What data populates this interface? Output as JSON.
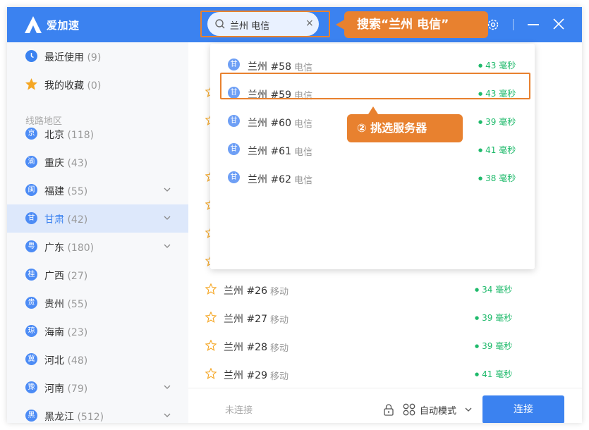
{
  "app": {
    "name": "爱加速"
  },
  "search": {
    "value": "兰州 电信",
    "clear": "×"
  },
  "callouts": {
    "search": "搜索“兰州 电信”",
    "pick": "② 挑选服务器"
  },
  "sidebar": {
    "top": [
      {
        "label": "最近使用",
        "count": "(9)"
      },
      {
        "label": "我的收藏",
        "count": "(0)"
      }
    ],
    "section_label": "线路地区",
    "regions": [
      {
        "badge": "京",
        "label": "北京",
        "count": "(118)",
        "expand": false
      },
      {
        "badge": "渝",
        "label": "重庆",
        "count": "(43)",
        "expand": false
      },
      {
        "badge": "闽",
        "label": "福建",
        "count": "(55)",
        "expand": true
      },
      {
        "badge": "甘",
        "label": "甘肃",
        "count": "(42)",
        "expand": true,
        "active": true
      },
      {
        "badge": "粤",
        "label": "广东",
        "count": "(180)",
        "expand": true
      },
      {
        "badge": "桂",
        "label": "广西",
        "count": "(27)",
        "expand": false
      },
      {
        "badge": "贵",
        "label": "贵州",
        "count": "(55)",
        "expand": false
      },
      {
        "badge": "琼",
        "label": "海南",
        "count": "(23)",
        "expand": false
      },
      {
        "badge": "冀",
        "label": "河北",
        "count": "(48)",
        "expand": false
      },
      {
        "badge": "豫",
        "label": "河南",
        "count": "(79)",
        "expand": true
      },
      {
        "badge": "黑",
        "label": "黑龙江",
        "count": "(512)",
        "expand": true
      }
    ]
  },
  "servers": [
    {
      "name": "兰州 #26",
      "isp": "移动",
      "latency": "34 毫秒"
    },
    {
      "name": "兰州 #27",
      "isp": "移动",
      "latency": "39 毫秒"
    },
    {
      "name": "兰州 #28",
      "isp": "移动",
      "latency": "39 毫秒"
    },
    {
      "name": "兰州 #29",
      "isp": "移动",
      "latency": "41 毫秒"
    }
  ],
  "dropdown": [
    {
      "badge": "甘",
      "name": "兰州 #58",
      "isp": "电信",
      "latency": "43 毫秒"
    },
    {
      "badge": "甘",
      "name": "兰州 #59",
      "isp": "电信",
      "latency": "43 毫秒"
    },
    {
      "badge": "甘",
      "name": "兰州 #60",
      "isp": "电信",
      "latency": "39 毫秒"
    },
    {
      "badge": "甘",
      "name": "兰州 #61",
      "isp": "电信",
      "latency": "41 毫秒"
    },
    {
      "badge": "甘",
      "name": "兰州 #62",
      "isp": "电信",
      "latency": "38 毫秒"
    }
  ],
  "footer": {
    "status": "未连接",
    "mode": "自动模式",
    "connect": "连接"
  },
  "colors": {
    "accent": "#3b82f0",
    "callout": "#e8812f",
    "latency": "#1fba6b"
  }
}
